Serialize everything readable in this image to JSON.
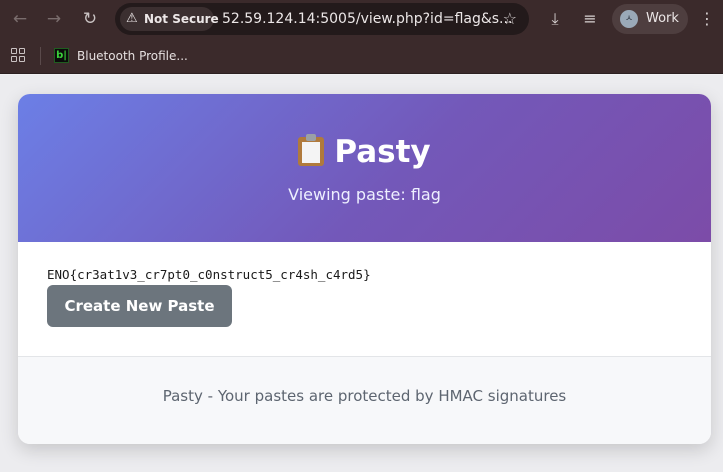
{
  "browser": {
    "security_label": "Not Secure",
    "url": "52.59.124.14:5005/view.php?id=flag&s...",
    "profile_label": "Work",
    "profile_initial": "ㅅ",
    "bookmarks": [
      {
        "label": "Bluetooth Profile...",
        "favicon_text": "b|"
      }
    ]
  },
  "app": {
    "title": "Pasty",
    "subtitle": "Viewing paste: flag",
    "paste_content": "ENO{cr3at1v3_cr7pt0_c0nstruct5_cr4sh_c4rd5}",
    "new_paste_label": "Create New Paste",
    "footer_text": "Pasty - Your pastes are protected by HMAC signatures"
  },
  "colors": {
    "header_gradient_start": "#6c7fe6",
    "header_gradient_end": "#7c4ca8",
    "button_bg": "#6c757d",
    "chrome_bg": "#3b2a2b"
  }
}
